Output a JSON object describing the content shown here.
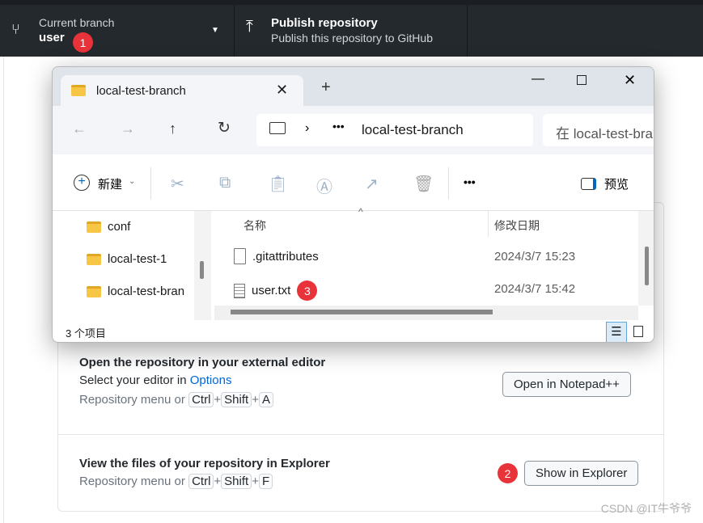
{
  "topbar": {
    "branch_label": "Current branch",
    "branch_name": "user",
    "branch_badge": "1",
    "publish_title": "Publish repository",
    "publish_sub": "Publish this repository to GitHub"
  },
  "card": {
    "editor": {
      "title": "Open the repository in your external editor",
      "sub_prefix": "Select your editor in ",
      "sub_link": "Options",
      "hint_prefix": "Repository menu or",
      "keys": [
        "Ctrl",
        "Shift",
        "A"
      ],
      "button": "Open in Notepad++"
    },
    "explorer": {
      "title": "View the files of your repository in Explorer",
      "hint_prefix": "Repository menu or",
      "keys": [
        "Ctrl",
        "Shift",
        "F"
      ],
      "button": "Show in Explorer",
      "badge": "2"
    }
  },
  "explorer_window": {
    "tab_title": "local-test-branch",
    "new_tab": "+",
    "address": "local-test-branch",
    "search_placeholder": "在 local-test-bra",
    "toolbar": {
      "new_label": "新建",
      "more": "•••",
      "preview_label": "预览"
    },
    "nav_items": [
      "conf",
      "local-test-1",
      "local-test-bran"
    ],
    "columns": {
      "name": "名称",
      "date": "修改日期"
    },
    "files": [
      {
        "name": ".gitattributes",
        "date": "2024/3/7 15:23"
      },
      {
        "name": "user.txt",
        "date": "2024/3/7 15:42",
        "badge": "3"
      }
    ],
    "status": "3 个项目"
  },
  "watermark": "CSDN @IT牛爷爷"
}
